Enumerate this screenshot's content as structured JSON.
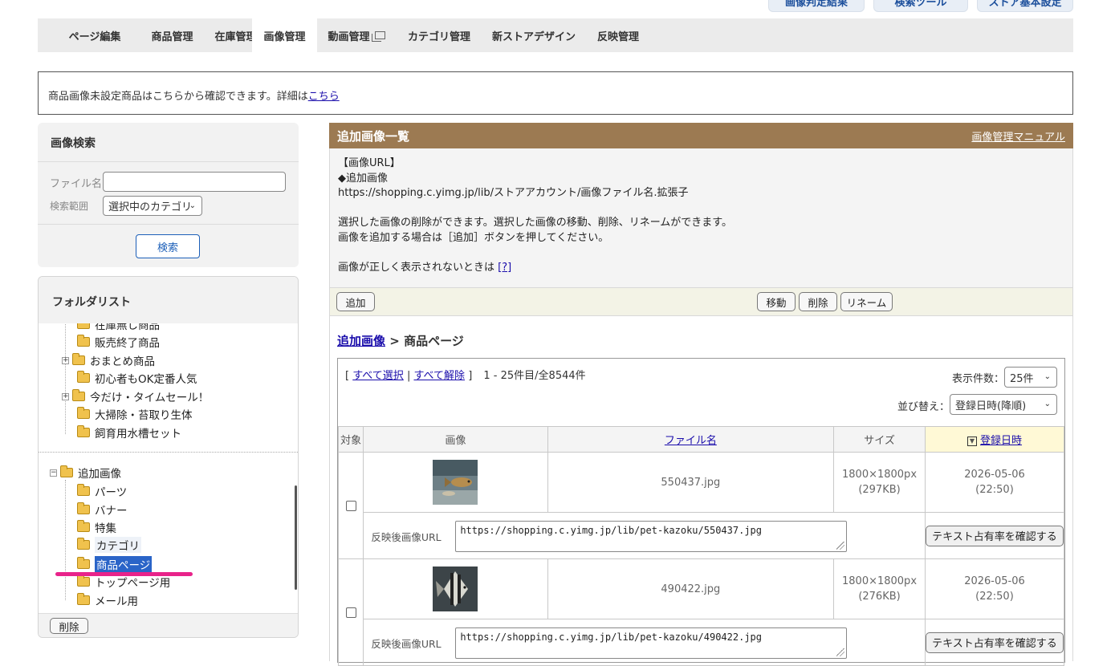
{
  "top_buttons": [
    "画像判定結果",
    "検索ツール",
    "ストア基本設定"
  ],
  "tabs": [
    {
      "label": "ページ編集"
    },
    {
      "label": "商品管理"
    },
    {
      "label": "在庫管理"
    },
    {
      "label": "画像管理"
    },
    {
      "label": "動画管理"
    },
    {
      "label": "カテゴリ管理"
    },
    {
      "label": "新ストアデザイン"
    },
    {
      "label": "反映管理"
    }
  ],
  "notice": {
    "text": "商品画像未設定商品はこちらから確認できます。詳細は",
    "link": "こちら"
  },
  "image_search": {
    "title": "画像検索",
    "filename_label": "ファイル名",
    "filename_value": "",
    "scope_label": "検索範囲",
    "scope_value": "選択中のカテゴリ",
    "search_button": "検索"
  },
  "folder_list": {
    "title": "フォルダリスト",
    "items_top": [
      "在庫無し商品",
      "販売終了商品",
      "おまとめ商品",
      "初心者もOK定番人気",
      "今だけ・タイムセール！",
      "大掃除・苔取り生体",
      "飼育用水槽セット"
    ],
    "root": "追加画像",
    "children": [
      "パーツ",
      "バナー",
      "特集",
      "カテゴリ",
      "商品ページ",
      "トップページ用",
      "メール用"
    ],
    "selected": "商品ページ",
    "delete_button": "削除"
  },
  "main": {
    "title": "追加画像一覧",
    "manual_link": "画像管理マニュアル",
    "info_lines": [
      "【画像URL】",
      "◆追加画像",
      "https://shopping.c.yimg.jp/lib/ストアアカウント/画像ファイル名.拡張子",
      "",
      "選択した画像の削除ができます。選択した画像の移動、削除、リネームができます。",
      "画像を追加する場合は［追加］ボタンを押してください。",
      "",
      "画像が正しく表示されないときは"
    ],
    "help_link": "[?]",
    "buttons": {
      "add": "追加",
      "move": "移動",
      "delete": "削除",
      "rename": "リネーム"
    },
    "breadcrumb": {
      "root": "追加画像",
      "sep": ">",
      "current": "商品ページ"
    },
    "select_all": "すべて選択",
    "deselect_all": "すべて解除",
    "bracket_open": "[",
    "bracket_close": "]",
    "bar": "|",
    "range_text": "1 - 25件目/全8544件",
    "per_page_label": "表示件数：",
    "per_page_value": "25件",
    "sort_label": "並び替え：",
    "sort_value": "登録日時(降順)",
    "columns": {
      "target": "対象",
      "image": "画像",
      "filename": "ファイル名",
      "size": "サイズ",
      "date": "登録日時"
    },
    "url_label": "反映後画像URL",
    "text_ratio_button": "テキスト占有率を確認する",
    "rows": [
      {
        "filename": "550437.jpg",
        "dims": "1800×1800px",
        "kb": "(297KB)",
        "date": "2026-05-06",
        "time": "(22:50)",
        "url": "https://shopping.c.yimg.jp/lib/pet-kazoku/550437.jpg"
      },
      {
        "filename": "490422.jpg",
        "dims": "1800×1800px",
        "kb": "(276KB)",
        "date": "2026-05-06",
        "time": "(22:50)",
        "url": "https://shopping.c.yimg.jp/lib/pet-kazoku/490422.jpg"
      }
    ]
  },
  "colors": {
    "header_brown": "#9c7a52",
    "selection_blue": "#2a64c8",
    "pink_mark": "#e8238a",
    "sorted_col": "#fff9d6"
  }
}
